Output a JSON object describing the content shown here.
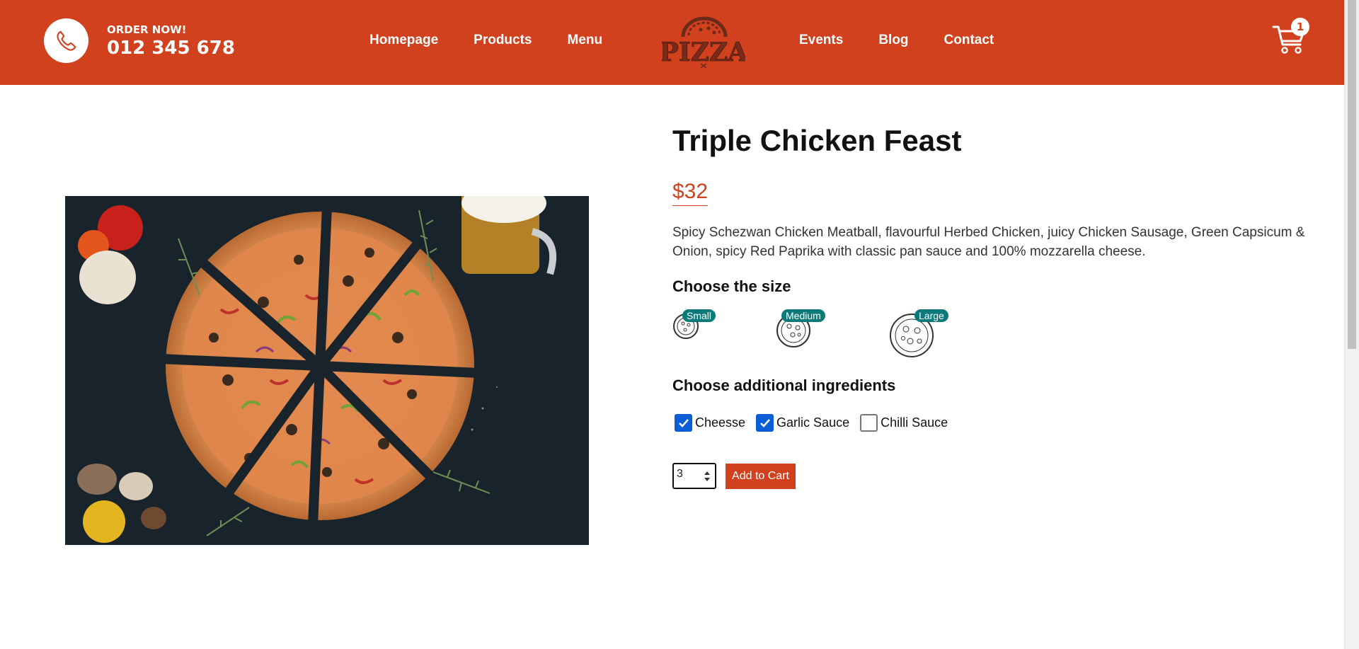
{
  "colors": {
    "brand": "#d1411e",
    "badge": "#0d7a7a",
    "checkbox": "#0a5fd8"
  },
  "header": {
    "order_label": "ORDER NOW!",
    "order_number": "012 345 678",
    "nav_left": [
      "Homepage",
      "Products",
      "Menu"
    ],
    "nav_right": [
      "Events",
      "Blog",
      "Contact"
    ],
    "logo_text": "PIZZA",
    "cart_count": "1"
  },
  "product": {
    "title": "Triple Chicken Feast",
    "price": "$32",
    "description": "Spicy Schezwan Chicken Meatball, flavourful Herbed Chicken, juicy Chicken Sausage, Green Capsicum & Onion, spicy Red Paprika with classic pan sauce and 100% mozzarella cheese.",
    "size_title": "Choose the size",
    "sizes": [
      "Small",
      "Medium",
      "Large"
    ],
    "ingredients_title": "Choose additional ingredients",
    "ingredients": [
      {
        "label": "Cheesse",
        "checked": true
      },
      {
        "label": "Garlic Sauce",
        "checked": true
      },
      {
        "label": "Chilli Sauce",
        "checked": false
      }
    ],
    "quantity": "3",
    "add_to_cart": "Add to Cart"
  }
}
